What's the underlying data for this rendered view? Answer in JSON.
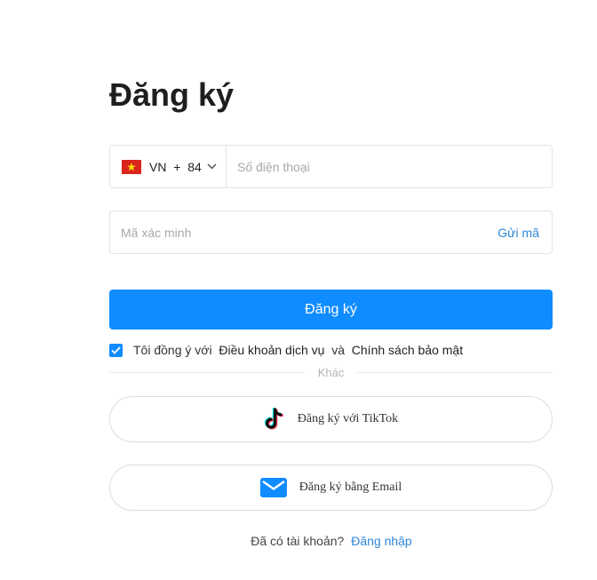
{
  "title": "Đăng ký",
  "phone": {
    "country_code": "VN",
    "plus": "+",
    "dial_code": "84",
    "placeholder": "Số điện thoại",
    "value": ""
  },
  "verification": {
    "placeholder": "Mã xác minh",
    "value": "",
    "send_label": "Gửi mã"
  },
  "submit_label": "Đăng ký",
  "agreement": {
    "checked": true,
    "prefix": "Tôi đồng ý với",
    "terms": "Điều khoản dịch vụ",
    "and": "và",
    "privacy": "Chính sách bảo mật"
  },
  "divider_label": "Khác",
  "social": {
    "tiktok_label": "Đăng ký với TikTok",
    "email_label": "Đăng ký bằng Email"
  },
  "footer": {
    "question": "Đã có tài khoản?",
    "login_label": "Đăng nhập"
  },
  "colors": {
    "accent": "#0f8cff",
    "link": "#2f86d6",
    "flag_red": "#da251d",
    "flag_star": "#ffde00"
  },
  "icons": {
    "flag": "vietnam-flag-icon",
    "chevron": "chevron-down-icon",
    "check": "check-icon",
    "tiktok": "tiktok-icon",
    "email": "email-icon"
  }
}
